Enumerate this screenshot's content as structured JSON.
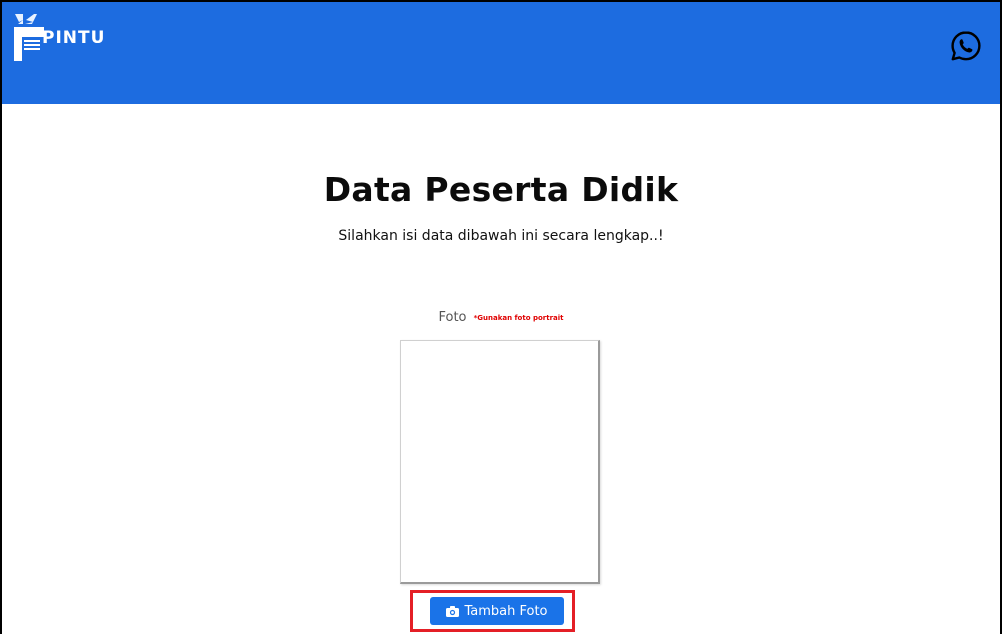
{
  "header": {
    "brand_text": "PINTU",
    "bg_color": "#1d6ce0",
    "right_icon": "whatsapp-icon"
  },
  "main": {
    "title": "Data Peserta Didik",
    "subtitle": "Silahkan isi data dibawah ini secara lengkap..!",
    "photo": {
      "label": "Foto",
      "note": "*Gunakan foto portrait",
      "note_color": "#e00000"
    },
    "add_photo_button": {
      "label": "Tambah Foto",
      "icon": "camera-icon",
      "color": "#1a73e8"
    },
    "highlight_color": "#e41f26"
  }
}
